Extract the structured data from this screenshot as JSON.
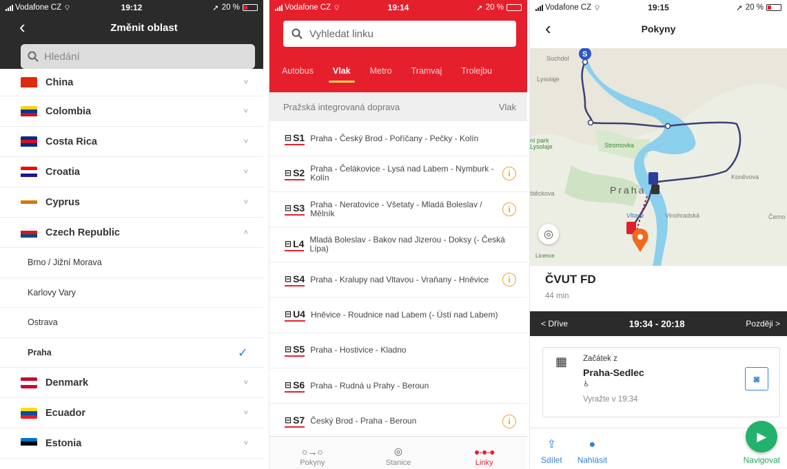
{
  "panel1": {
    "status": {
      "carrier": "Vodafone CZ",
      "time": "19:12",
      "battery": "20 %"
    },
    "title": "Změnit oblast",
    "search_placeholder": "Hledání",
    "countries": [
      {
        "name": "China",
        "chevron": "˅",
        "flag": [
          "#de2910",
          "#de2910",
          "#de2910"
        ]
      },
      {
        "name": "Colombia",
        "chevron": "˅",
        "flag": [
          "#fcd116",
          "#003893",
          "#ce1126"
        ]
      },
      {
        "name": "Costa Rica",
        "chevron": "˅",
        "flag": [
          "#002b7f",
          "#ce1126",
          "#002b7f"
        ]
      },
      {
        "name": "Croatia",
        "chevron": "˅",
        "flag": [
          "#ff0000",
          "#ffffff",
          "#171796"
        ]
      },
      {
        "name": "Cyprus",
        "chevron": "˅",
        "flag": [
          "#ffffff",
          "#d57800",
          "#ffffff"
        ]
      },
      {
        "name": "Czech Republic",
        "chevron": "˄",
        "flag": [
          "#ffffff",
          "#d7141a",
          "#11457e"
        ]
      }
    ],
    "cities": [
      {
        "name": "Brno / Jižní Morava",
        "selected": false
      },
      {
        "name": "Karlovy Vary",
        "selected": false
      },
      {
        "name": "Ostrava",
        "selected": false
      },
      {
        "name": "Praha",
        "selected": true,
        "check": "✓"
      }
    ],
    "countries_after": [
      {
        "name": "Denmark",
        "chevron": "˅",
        "flag": [
          "#c60c30",
          "#ffffff",
          "#c60c30"
        ]
      },
      {
        "name": "Ecuador",
        "chevron": "˅",
        "flag": [
          "#ffdd00",
          "#034ea2",
          "#ed1c24"
        ]
      },
      {
        "name": "Estonia",
        "chevron": "˅",
        "flag": [
          "#0072ce",
          "#000000",
          "#ffffff"
        ]
      }
    ]
  },
  "panel2": {
    "status": {
      "carrier": "Vodafone CZ",
      "time": "19:14",
      "battery": "20 %"
    },
    "search_placeholder": "Vyhledat linku",
    "tabs": [
      {
        "label": "Autobus",
        "active": false
      },
      {
        "label": "Vlak",
        "active": true
      },
      {
        "label": "Metro",
        "active": false
      },
      {
        "label": "Tramvaj",
        "active": false
      },
      {
        "label": "Trolejbu",
        "active": false
      }
    ],
    "agency": "Pražská integrovaná doprava",
    "agency_type": "Vlak",
    "lines": [
      {
        "code": "S1",
        "route": "Praha - Český Brod - Poříčany - Pečky - Kolín",
        "info": false
      },
      {
        "code": "S2",
        "route": "Praha - Čelákovice - Lysá nad Labem - Nymburk - Kolín",
        "info": true
      },
      {
        "code": "S3",
        "route": "Praha - Neratovice - Všetaty - Mladá Boleslav / Mělník",
        "info": true
      },
      {
        "code": "L4",
        "route": "Mladá Boleslav - Bakov nad Jizerou - Doksy (- Česká Lípa)",
        "info": false
      },
      {
        "code": "S4",
        "route": "Praha - Kralupy nad Vltavou - Vraňany - Hněvice",
        "info": true
      },
      {
        "code": "U4",
        "route": "Hněvice - Roudnice nad Labem (- Ústí nad Labem)",
        "info": false
      },
      {
        "code": "S5",
        "route": "Praha - Hostivice - Kladno",
        "info": false
      },
      {
        "code": "S6",
        "route": "Praha - Rudná u Prahy - Beroun",
        "info": false
      },
      {
        "code": "S7",
        "route": "Český Brod - Praha - Beroun",
        "info": true
      }
    ],
    "bottom_nav": [
      {
        "label": "Pokyny",
        "icon": "route-icon",
        "glyph": "○→○",
        "active": false
      },
      {
        "label": "Stanice",
        "icon": "pin-icon",
        "glyph": "◎",
        "active": false
      },
      {
        "label": "Linky",
        "icon": "lines-icon",
        "glyph": "●-●-●",
        "active": true
      }
    ]
  },
  "panel3": {
    "status": {
      "carrier": "Vodafone CZ",
      "time": "19:15",
      "battery": "20 %"
    },
    "title": "Pokyny",
    "map_labels": {
      "suchdol": "Suchdol",
      "lysolaje": "Lysolaje",
      "park": "ní park\nLysolaje",
      "stromovka": "Stromovka",
      "praha": "Praha",
      "konevova": "Koněvova",
      "vinohradska": "Vinohradská",
      "vltava": "Vltava",
      "cernokostelecka": "Černo",
      "steckova": "štěckova",
      "licence": "Licence"
    },
    "destination": "ČVUT FD",
    "duration": "44 min",
    "earlier": "< Dříve",
    "later": "Později >",
    "time_range": "19:34 - 20:18",
    "step": {
      "label": "Začátek z",
      "stop": "Praha-Sedlec",
      "accessibility": "♿",
      "depart": "Vyražte v 19:34"
    },
    "actions": [
      {
        "label": "Sdílet",
        "icon": "share-icon",
        "glyph": "⇪"
      },
      {
        "label": "Nahlásit",
        "icon": "report-icon",
        "glyph": "●"
      }
    ],
    "navigate": "Navigovat",
    "accent": "#2f7fe0",
    "navigate_color": "#23b26b"
  },
  "colors": {
    "pid_red": "#e5202c",
    "dark": "#2b2b2b",
    "warning": "#f0a21d"
  }
}
